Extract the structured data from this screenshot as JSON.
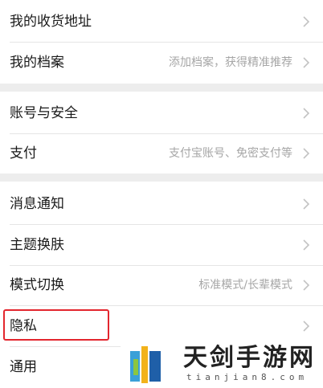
{
  "rows": {
    "address": {
      "label": "我的收货地址",
      "detail": ""
    },
    "profile": {
      "label": "我的档案",
      "detail": "添加档案，获得精准推荐"
    },
    "account_security": {
      "label": "账号与安全",
      "detail": ""
    },
    "payment": {
      "label": "支付",
      "detail": "支付宝账号、免密支付等"
    },
    "notifications": {
      "label": "消息通知",
      "detail": ""
    },
    "theme": {
      "label": "主题换肤",
      "detail": ""
    },
    "mode_switch": {
      "label": "模式切换",
      "detail": "标准模式/长辈模式"
    },
    "privacy": {
      "label": "隐私",
      "detail": ""
    },
    "general": {
      "label": "通用",
      "detail": ""
    }
  },
  "highlight_color": "#e3262e",
  "watermark": {
    "title": "天剑手游网",
    "subtitle": "tianjian8.com"
  }
}
